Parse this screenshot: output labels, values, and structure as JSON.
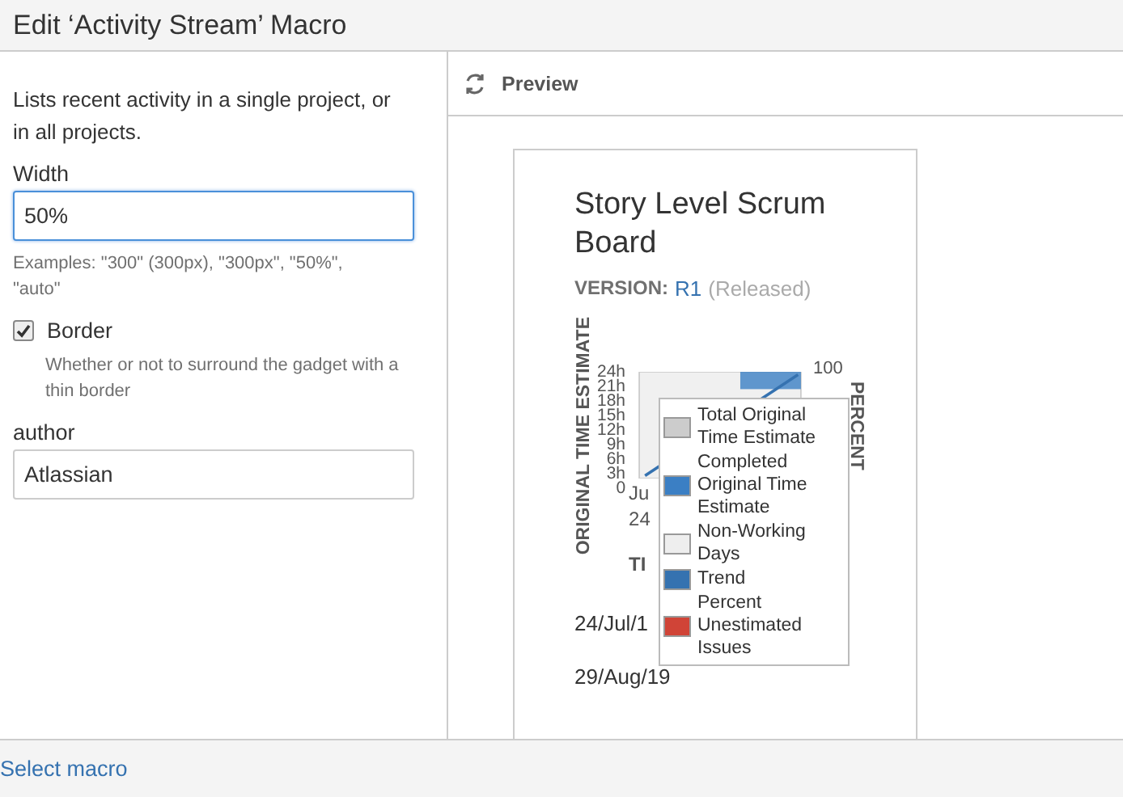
{
  "window": {
    "title": "Edit ‘Activity Stream’ Macro"
  },
  "form": {
    "description": "Lists recent activity in a single project, or in all projects.",
    "fields": [
      {
        "kind": "text",
        "label": "Width",
        "value": "50%",
        "focused": true,
        "hint": "Examples: \"300\" (300px), \"300px\", \"50%\", \"auto\""
      },
      {
        "kind": "checkbox",
        "label": "Border",
        "checked": true,
        "hint": "Whether or not to surround the gadget with a thin border"
      },
      {
        "kind": "text",
        "label": "author",
        "value": "Atlassian",
        "focused": false
      }
    ]
  },
  "preview": {
    "title": "Preview",
    "gadget": {
      "title": "Story Level Scrum Board",
      "version_label": "VERSION:",
      "version": "R1",
      "version_status": "(Released)",
      "chart": {
        "y_label": "ORIGINAL TIME ESTIMATE",
        "y_ticks": [
          "24h",
          "21h",
          "18h",
          "15h",
          "12h",
          "9h",
          "6h",
          "3h",
          "0"
        ],
        "right_label": "PERCENT",
        "right_ticks": [
          "100"
        ],
        "x_labels": [
          "Ju"
        ],
        "x_sub_labels": [
          "24"
        ],
        "x_title": [
          "TI"
        ],
        "legend": [
          {
            "label": "Total Original Time Estimate",
            "color": "#cccccc"
          },
          {
            "label": "Completed Original Time Estimate",
            "color": "#3b7fc4"
          },
          {
            "label": "Non-Working Days",
            "color": "#eeeeee"
          },
          {
            "label": "Trend",
            "color": "#3572b0"
          },
          {
            "label": "Percent Unestimated Issues",
            "color": "#d04437"
          }
        ]
      },
      "dates": [
        "24/Jul/1",
        "29/Aug/19"
      ]
    }
  },
  "footer": {
    "link": "Select macro"
  }
}
